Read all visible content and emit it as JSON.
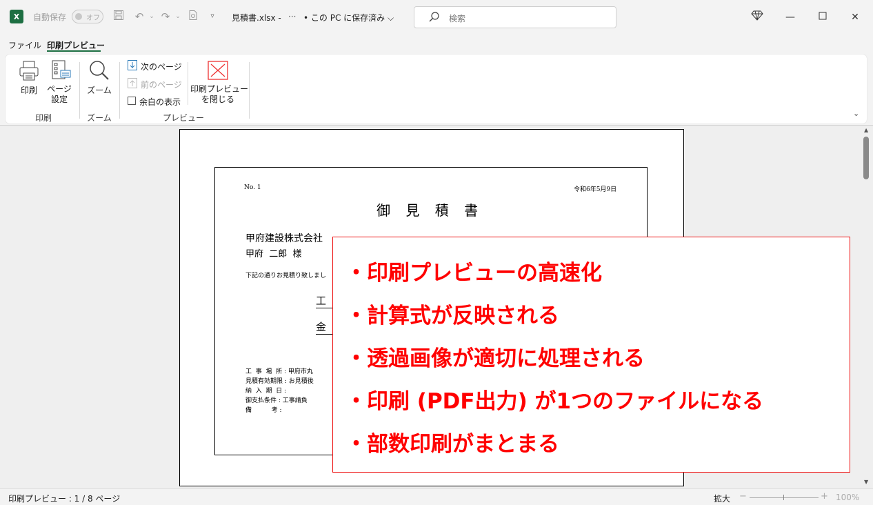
{
  "titlebar": {
    "app_icon": "X",
    "autosave_label": "自動保存",
    "autosave_state": "オフ",
    "filename": "見積書.xlsx  -",
    "file_status": "• この PC に保存済み",
    "search_placeholder": "検索",
    "icons": [
      "save-icon",
      "undo-icon",
      "redo-icon",
      "preview-icon",
      "customize-icon",
      "diamond-icon",
      "minimize-icon",
      "maximize-icon",
      "close-icon"
    ]
  },
  "tabs": {
    "file": "ファイル",
    "print_preview": "印刷プレビュー"
  },
  "ribbon": {
    "print_label": "印刷",
    "page_setup_label": "ページ\n設定",
    "group_print": "印刷",
    "zoom_label": "ズーム",
    "group_zoom": "ズーム",
    "next_page": "次のページ",
    "prev_page": "前のページ",
    "show_margins": "余白の表示",
    "close_preview": "印刷プレビュー\nを閉じる",
    "group_preview": "プレビュー"
  },
  "document": {
    "number": "No.  1",
    "date": "令和6年5月9日",
    "title": "御 見 積 書",
    "company": "甲府建設株式会社",
    "person": "甲府  二郎  様",
    "intro": "下記の通りお見積り致しまし",
    "field1": "工",
    "field2": "金",
    "details": [
      "工  事  場  所 : 甲府市丸",
      "見積有効期限 : お見積後",
      "納  入  期  日 :",
      "御支払条件 : 工事請負",
      "備          考 :"
    ]
  },
  "callout": {
    "items": [
      "・印刷プレビューの高速化",
      "・計算式が反映される",
      "・透過画像が適切に処理される",
      "・印刷 (PDF出力) が1つのファイルになる",
      "・部数印刷がまとまる"
    ],
    "accent_color": "#ff0000"
  },
  "statusbar": {
    "status": "印刷プレビュー : 1 / 8 ページ",
    "zoom_label": "拡大",
    "zoom_value": "100%"
  }
}
